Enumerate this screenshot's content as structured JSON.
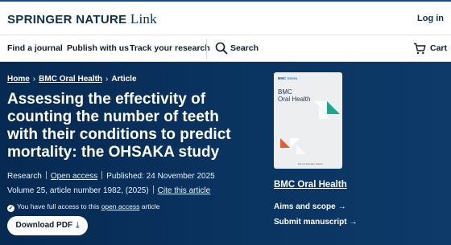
{
  "header": {
    "brand_caps": "SPRINGER NATURE",
    "brand_tail": " Link",
    "login": "Log in"
  },
  "nav": {
    "items": [
      "Find a journal",
      "Publish with us",
      "Track your research"
    ],
    "search": "Search",
    "cart": "Cart"
  },
  "breadcrumb": {
    "home": "Home",
    "journal": "BMC Oral Health",
    "current": "Article"
  },
  "article": {
    "title": "Assessing the effectivity of counting the number of teeth with their conditions to predict mortality: the OHSAKA study",
    "type": "Research",
    "access": "Open access",
    "published": "Published: 24 November 2025",
    "volume": "Volume 25, article number 1982, (2025)",
    "cite": "Cite this article",
    "access_note_prefix": "You have full access to this",
    "access_note_link": "open access",
    "access_note_suffix": "article",
    "download": "Download PDF"
  },
  "journal": {
    "cover_series_brand": "BMC",
    "cover_series_label": "Series",
    "cover_title_line1": "BMC",
    "cover_title_line2": "Oral Health",
    "cover_publisher": "Part of Springer Nature",
    "name": "BMC Oral Health",
    "aims": "Aims and scope",
    "submit": "Submit manuscript"
  },
  "colors": {
    "hero_bg": "#0a3461",
    "brand_navy": "#0d2f4f",
    "cover_teal": "#1aa68f",
    "cover_orange": "#e0602a"
  },
  "icons": {
    "search": "magnifier-icon",
    "cart": "cart-icon",
    "download": "download-arrow-icon",
    "check": "check-circle-icon",
    "arrow": "arrow-right-icon",
    "chevron": "chevron-right-icon"
  }
}
